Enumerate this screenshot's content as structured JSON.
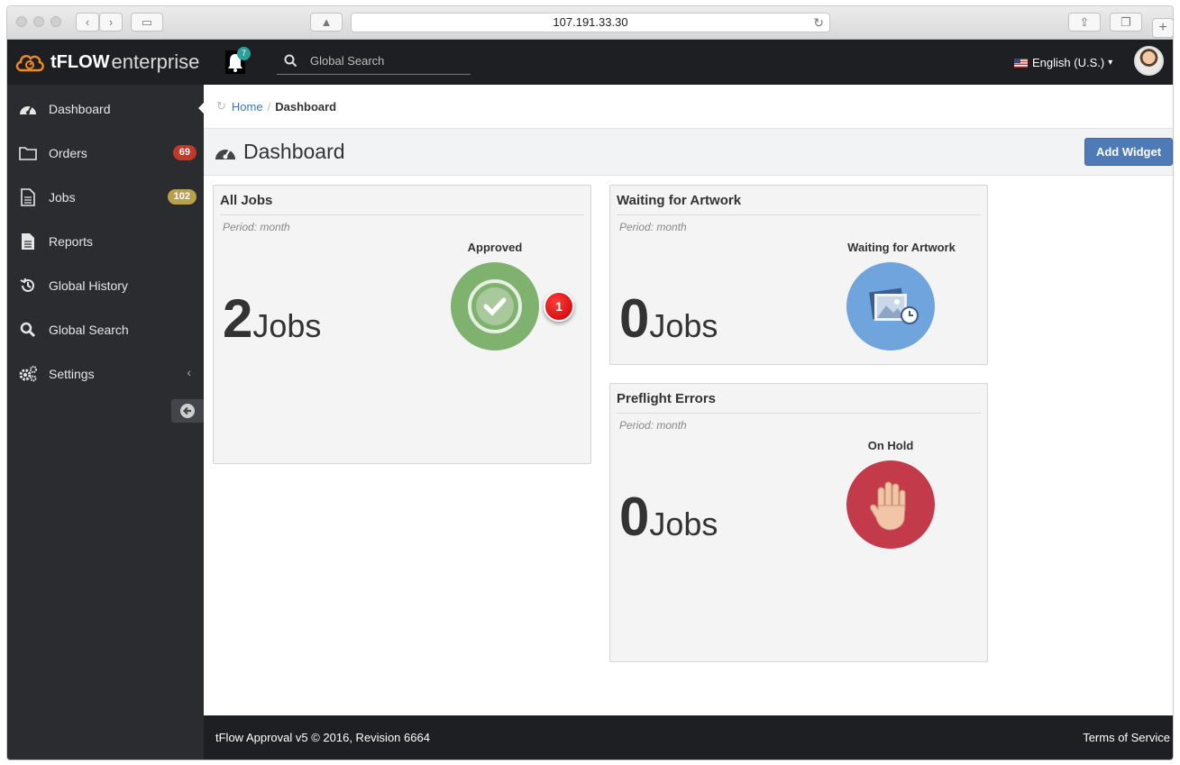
{
  "browser": {
    "url": "107.191.33.30",
    "icons": [
      "back-icon",
      "forward-icon",
      "sidebar-icon",
      "warning-icon",
      "reload-icon",
      "share-icon",
      "tabs-icon",
      "new-tab-icon"
    ]
  },
  "topbar": {
    "logo_bold": "tFLOW",
    "logo_light": "enterprise",
    "notifications_count": "7",
    "search_placeholder": "Global Search",
    "language": "English (U.S.)",
    "colors": {
      "bar": "#1e1f22",
      "accent": "#f08a24"
    }
  },
  "sidebar": {
    "items": [
      {
        "label": "Dashboard",
        "icon": "dashboard-gauge-icon"
      },
      {
        "label": "Orders",
        "icon": "folder-icon",
        "badge": "69",
        "badge_color": "#c0392b"
      },
      {
        "label": "Jobs",
        "icon": "file-icon",
        "badge": "102",
        "badge_color": "#b8a04c"
      },
      {
        "label": "Reports",
        "icon": "document-icon"
      },
      {
        "label": "Global History",
        "icon": "history-icon"
      },
      {
        "label": "Global Search",
        "icon": "search-icon"
      },
      {
        "label": "Settings",
        "icon": "gears-icon",
        "chevron": "‹"
      }
    ]
  },
  "breadcrumb": {
    "home": "Home",
    "sep": "/",
    "current": "Dashboard"
  },
  "page": {
    "title": "Dashboard",
    "add_widget": "Add Widget"
  },
  "widgets": [
    {
      "title": "All Jobs",
      "period": "Period: month",
      "count": "2",
      "unit": "Jobs",
      "status_label": "Approved",
      "status_icon": "check-icon",
      "color": "#7fb26f"
    },
    {
      "title": "Waiting for Artwork",
      "period": "Period: month",
      "count": "0",
      "unit": "Jobs",
      "status_label": "Waiting for Artwork",
      "status_icon": "image-clock-icon",
      "color": "#6fa4dc"
    },
    {
      "title": "Preflight Errors",
      "period": "Period: month",
      "count": "0",
      "unit": "Jobs",
      "status_label": "On Hold",
      "status_icon": "hand-stop-icon",
      "color": "#c33a4b"
    }
  ],
  "callout": "1",
  "footer": {
    "left": "tFlow Approval v5 © 2016, Revision 6664",
    "right": "Terms of Service"
  }
}
